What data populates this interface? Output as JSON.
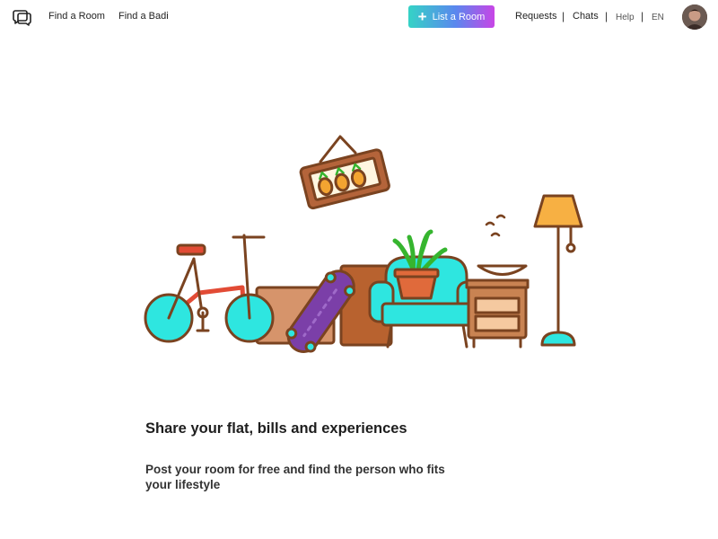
{
  "nav": {
    "logo_icon": "chat-bubbles-icon",
    "find_room": "Find a Room",
    "find_badi": "Find a Badi",
    "list_room": "List a Room",
    "list_room_icon": "plus-icon",
    "requests": "Requests",
    "chats": "Chats",
    "help": "Help",
    "language": "EN",
    "separator": "|"
  },
  "hero": {
    "headline": "Share your flat, bills and experiences",
    "subtext": "Post your room for free and find the person who fits your lifestyle",
    "illustration": "furniture-illustration"
  },
  "colors": {
    "cyan": "#2ee6e0",
    "outline": "#7a4320",
    "brand_gradient_start": "#35d3c6",
    "brand_gradient_end": "#c845e6"
  }
}
